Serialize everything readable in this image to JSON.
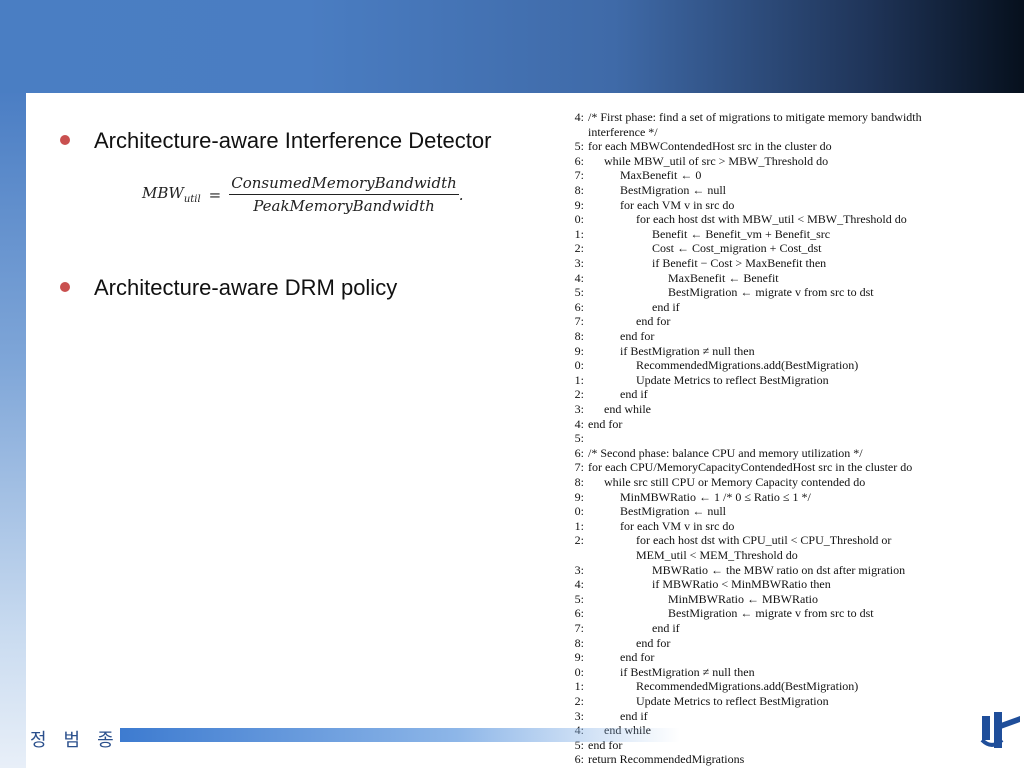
{
  "bullets": [
    "Architecture-aware Interference Detector",
    "Architecture-aware DRM policy"
  ],
  "formula": {
    "lhs": "MBW",
    "lhs_sub": "util",
    "equals": "=",
    "numerator": "ConsumedMemoryBandwidth",
    "denominator": "PeakMemoryBandwidth",
    "end": "."
  },
  "footer": {
    "author": "정 범 종"
  },
  "algorithm": [
    {
      "n": "4:",
      "indent": 0,
      "text": "/* First phase: find a set of migrations to mitigate memory bandwidth"
    },
    {
      "n": "",
      "indent": 0,
      "text": "interference */"
    },
    {
      "n": "5:",
      "indent": 0,
      "text": "for each MBWContendedHost src in the cluster do"
    },
    {
      "n": "6:",
      "indent": 1,
      "text": "while MBW_util of src > MBW_Threshold do"
    },
    {
      "n": "7:",
      "indent": 2,
      "text": "MaxBenefit ← 0"
    },
    {
      "n": "8:",
      "indent": 2,
      "text": "BestMigration ← null"
    },
    {
      "n": "9:",
      "indent": 2,
      "text": "for each VM v in src do"
    },
    {
      "n": "0:",
      "indent": 3,
      "text": "for each host dst with MBW_util < MBW_Threshold do"
    },
    {
      "n": "1:",
      "indent": 4,
      "text": "Benefit ← Benefit_vm + Benefit_src"
    },
    {
      "n": "2:",
      "indent": 4,
      "text": "Cost ← Cost_migration + Cost_dst"
    },
    {
      "n": "3:",
      "indent": 4,
      "text": "if Benefit − Cost > MaxBenefit then"
    },
    {
      "n": "4:",
      "indent": 5,
      "text": "MaxBenefit ← Benefit"
    },
    {
      "n": "5:",
      "indent": 5,
      "text": "BestMigration ← migrate v from src to dst"
    },
    {
      "n": "6:",
      "indent": 4,
      "text": "end if"
    },
    {
      "n": "7:",
      "indent": 3,
      "text": "end for"
    },
    {
      "n": "8:",
      "indent": 2,
      "text": "end for"
    },
    {
      "n": "9:",
      "indent": 2,
      "text": "if BestMigration ≠ null then"
    },
    {
      "n": "0:",
      "indent": 3,
      "text": "RecommendedMigrations.add(BestMigration)"
    },
    {
      "n": "1:",
      "indent": 3,
      "text": "Update Metrics to reflect BestMigration"
    },
    {
      "n": "2:",
      "indent": 2,
      "text": "end if"
    },
    {
      "n": "3:",
      "indent": 1,
      "text": "end while"
    },
    {
      "n": "4:",
      "indent": 0,
      "text": "end for"
    },
    {
      "n": "5:",
      "indent": 0,
      "text": ""
    },
    {
      "n": "6:",
      "indent": 0,
      "text": "/* Second phase: balance CPU and memory utilization */"
    },
    {
      "n": "7:",
      "indent": 0,
      "text": "for each CPU/MemoryCapacityContendedHost src in the cluster do"
    },
    {
      "n": "8:",
      "indent": 1,
      "text": "while src still CPU or Memory Capacity contended do"
    },
    {
      "n": "9:",
      "indent": 2,
      "text": "MinMBWRatio ← 1    /* 0 ≤ Ratio ≤ 1 */"
    },
    {
      "n": "0:",
      "indent": 2,
      "text": "BestMigration ← null"
    },
    {
      "n": "1:",
      "indent": 2,
      "text": "for each VM v in src do"
    },
    {
      "n": "2:",
      "indent": 3,
      "text": "for each host dst with CPU_util < CPU_Threshold or"
    },
    {
      "n": "",
      "indent": 3,
      "text": "MEM_util < MEM_Threshold do"
    },
    {
      "n": "3:",
      "indent": 4,
      "text": "MBWRatio ← the MBW ratio on dst after migration"
    },
    {
      "n": "4:",
      "indent": 4,
      "text": "if MBWRatio < MinMBWRatio then"
    },
    {
      "n": "5:",
      "indent": 5,
      "text": "MinMBWRatio ← MBWRatio"
    },
    {
      "n": "6:",
      "indent": 5,
      "text": "BestMigration ← migrate v from src to dst"
    },
    {
      "n": "7:",
      "indent": 4,
      "text": "end if"
    },
    {
      "n": "8:",
      "indent": 3,
      "text": "end for"
    },
    {
      "n": "9:",
      "indent": 2,
      "text": "end for"
    },
    {
      "n": "0:",
      "indent": 2,
      "text": "if BestMigration ≠ null then"
    },
    {
      "n": "1:",
      "indent": 3,
      "text": "RecommendedMigrations.add(BestMigration)"
    },
    {
      "n": "2:",
      "indent": 3,
      "text": "Update Metrics to reflect BestMigration"
    },
    {
      "n": "3:",
      "indent": 2,
      "text": "end if"
    },
    {
      "n": "4:",
      "indent": 1,
      "text": "end while"
    },
    {
      "n": "5:",
      "indent": 0,
      "text": "end for"
    },
    {
      "n": "6:",
      "indent": 0,
      "text": "return RecommendedMigrations"
    }
  ]
}
